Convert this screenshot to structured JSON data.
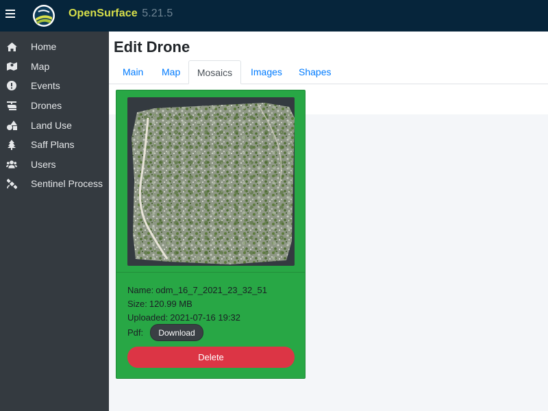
{
  "app": {
    "brand_a": "Open",
    "brand_b": "Surface",
    "version": "5.21.5"
  },
  "colors": {
    "topbar": "#06253b",
    "sidebar": "#343a40",
    "card": "#28a745",
    "delete": "#dc3545",
    "link": "#007bff"
  },
  "sidebar": {
    "items": [
      {
        "label": "Home",
        "icon": "home-icon"
      },
      {
        "label": "Map",
        "icon": "map-icon"
      },
      {
        "label": "Events",
        "icon": "exclamation-circle-icon"
      },
      {
        "label": "Drones",
        "icon": "helicopter-icon"
      },
      {
        "label": "Land Use",
        "icon": "shapes-icon"
      },
      {
        "label": "Saff Plans",
        "icon": "tree-icon"
      },
      {
        "label": "Users",
        "icon": "users-icon"
      },
      {
        "label": "Sentinel Process",
        "icon": "satellite-icon"
      }
    ]
  },
  "page": {
    "title": "Edit Drone"
  },
  "tabs": [
    {
      "label": "Main"
    },
    {
      "label": "Map"
    },
    {
      "label": "Mosaics",
      "active": true
    },
    {
      "label": "Images"
    },
    {
      "label": "Shapes"
    }
  ],
  "mosaic": {
    "name_label": "Name:",
    "name": "odm_16_7_2021_23_32_51",
    "size_label": "Size:",
    "size": "120.99 MB",
    "uploaded_label": "Uploaded:",
    "uploaded": "2021-07-16 19:32",
    "pdf_label": "Pdf:",
    "download_label": "Download",
    "delete_label": "Delete"
  }
}
